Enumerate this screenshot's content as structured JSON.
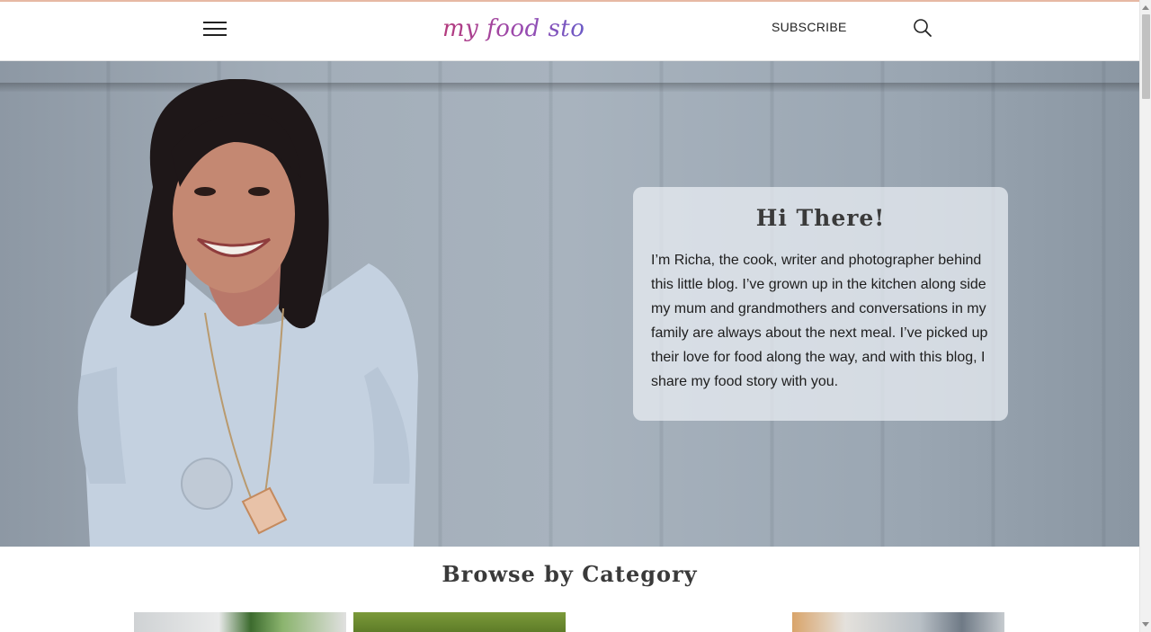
{
  "header": {
    "logo_text": "my food story",
    "subscribe_label": "SUBSCRIBE",
    "menu_icon": "hamburger-menu-icon",
    "search_icon": "search-icon"
  },
  "hero": {
    "photo_icon": "portrait-photo",
    "card_title": "Hi There!",
    "card_text": "I’m Richa, the cook, writer and photographer behind this little blog. I’ve grown up in the kitchen along side my mum and grandmothers and conversations in my family are always about the next meal. I’ve picked up their love for food along the way, and with this blog, I share my food story with you."
  },
  "browse": {
    "title": "Browse by Category"
  },
  "colors": {
    "accent_line": "#e7b9a4",
    "logo_gradient_start": "#b43a7c",
    "logo_gradient_end": "#6a5bc7",
    "card_background": "#ecf0f5"
  }
}
